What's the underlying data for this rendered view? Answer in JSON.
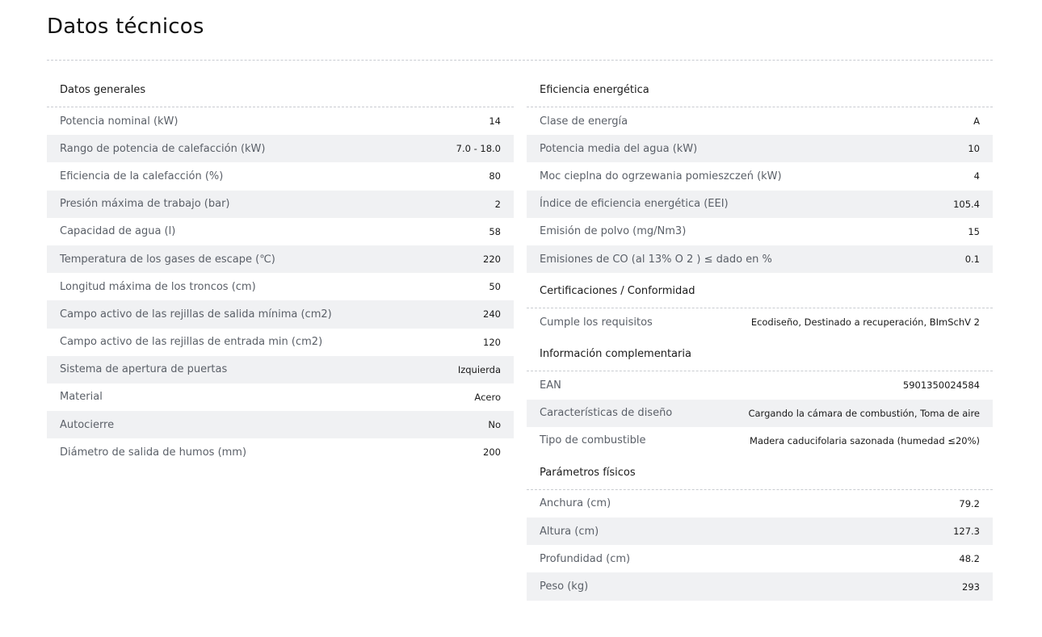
{
  "title": "Datos técnicos",
  "left": {
    "heading": "Datos generales",
    "rows": [
      {
        "label": "Potencia nominal (kW)",
        "value": "14"
      },
      {
        "label": "Rango de potencia de calefacción (kW)",
        "value": "7.0 - 18.0"
      },
      {
        "label": "Eficiencia de la calefacción (%)",
        "value": "80"
      },
      {
        "label": "Presión máxima de trabajo (bar)",
        "value": "2"
      },
      {
        "label": "Capacidad de agua (l)",
        "value": "58"
      },
      {
        "label": "Temperatura de los gases de escape (℃)",
        "value": "220"
      },
      {
        "label": "Longitud máxima de los troncos (cm)",
        "value": "50"
      },
      {
        "label": "Campo activo de las rejillas de salida mínima (cm2)",
        "value": "240"
      },
      {
        "label": "Campo activo de las rejillas de entrada min (cm2)",
        "value": "120"
      },
      {
        "label": "Sistema de apertura de puertas",
        "value": "Izquierda"
      },
      {
        "label": "Material",
        "value": "Acero"
      },
      {
        "label": "Autocierre",
        "value": "No"
      },
      {
        "label": "Diámetro de salida de humos (mm)",
        "value": "200"
      }
    ]
  },
  "right": {
    "energy": {
      "heading": "Eficiencia energética",
      "rows": [
        {
          "label": "Clase de energía",
          "value": "A"
        },
        {
          "label": "Potencia media del agua (kW)",
          "value": "10"
        },
        {
          "label": "Moc cieplna do ogrzewania pomieszczeń (kW)",
          "value": "4"
        },
        {
          "label": "Índice de eficiencia energética (EEI)",
          "value": "105.4"
        },
        {
          "label": "Emisión de polvo (mg/Nm3)",
          "value": "15"
        },
        {
          "label": "Emisiones de CO (al 13% O 2 ) ≤ dado en %",
          "value": "0.1"
        }
      ]
    },
    "cert": {
      "heading": "Certificaciones / Conformidad",
      "rows": [
        {
          "label": "Cumple los requisitos",
          "value": "Ecodiseño, Destinado a recuperación, BImSchV 2"
        }
      ]
    },
    "extra": {
      "heading": "Información complementaria",
      "rows": [
        {
          "label": "EAN",
          "value": "5901350024584"
        },
        {
          "label": "Características de diseño",
          "value": "Cargando la cámara de combustión, Toma de aire"
        },
        {
          "label": "Tipo de combustible",
          "value": "Madera caducifolaria sazonada (humedad ≤20%)"
        }
      ]
    },
    "physical": {
      "heading": "Parámetros físicos",
      "rows": [
        {
          "label": "Anchura (cm)",
          "value": "79.2"
        },
        {
          "label": "Altura (cm)",
          "value": "127.3"
        },
        {
          "label": "Profundidad (cm)",
          "value": "48.2"
        },
        {
          "label": "Peso (kg)",
          "value": "293"
        }
      ]
    }
  }
}
